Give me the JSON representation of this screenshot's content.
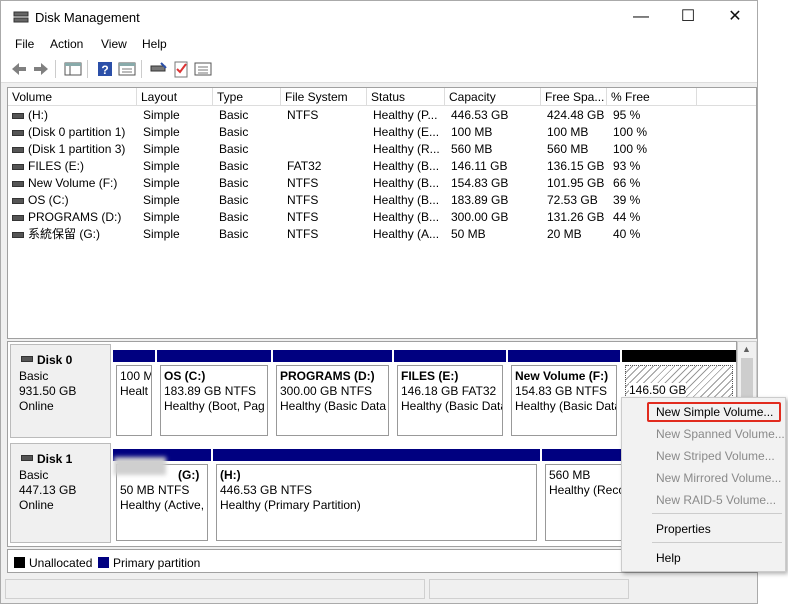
{
  "window": {
    "title": "Disk Management",
    "controls": {
      "minimize": "—",
      "maximize": "☐",
      "close": "✕"
    }
  },
  "menu": [
    "File",
    "Action",
    "View",
    "Help"
  ],
  "toolbar_icons": [
    "back-arrow-icon",
    "forward-arrow-icon",
    "console-tree-icon",
    "help-icon",
    "properties-icon",
    "disk-icon",
    "checklist-icon",
    "list-view-icon"
  ],
  "volume_list": {
    "columns": [
      "Volume",
      "Layout",
      "Type",
      "File System",
      "Status",
      "Capacity",
      "Free Spa...",
      "% Free"
    ],
    "rows": [
      [
        "(H:)",
        "Simple",
        "Basic",
        "NTFS",
        "Healthy (P...",
        "446.53 GB",
        "424.48 GB",
        "95 %"
      ],
      [
        "(Disk 0 partition 1)",
        "Simple",
        "Basic",
        "",
        "Healthy (E...",
        "100 MB",
        "100 MB",
        "100 %"
      ],
      [
        "(Disk 1 partition 3)",
        "Simple",
        "Basic",
        "",
        "Healthy (R...",
        "560 MB",
        "560 MB",
        "100 %"
      ],
      [
        "FILES (E:)",
        "Simple",
        "Basic",
        "FAT32",
        "Healthy (B...",
        "146.11 GB",
        "136.15 GB",
        "93 %"
      ],
      [
        "New Volume (F:)",
        "Simple",
        "Basic",
        "NTFS",
        "Healthy (B...",
        "154.83 GB",
        "101.95 GB",
        "66 %"
      ],
      [
        "OS (C:)",
        "Simple",
        "Basic",
        "NTFS",
        "Healthy (B...",
        "183.89 GB",
        "72.53 GB",
        "39 %"
      ],
      [
        "PROGRAMS (D:)",
        "Simple",
        "Basic",
        "NTFS",
        "Healthy (B...",
        "300.00 GB",
        "131.26 GB",
        "44 %"
      ],
      [
        "系統保留 (G:)",
        "Simple",
        "Basic",
        "NTFS",
        "Healthy (A...",
        "50 MB",
        "20 MB",
        "40 %"
      ]
    ]
  },
  "disks": [
    {
      "name": "Disk 0",
      "type": "Basic",
      "size": "931.50 GB",
      "status": "Online",
      "partitions": [
        {
          "title": "",
          "line1": "100 M",
          "line2": "Healt"
        },
        {
          "title": "OS  (C:)",
          "line1": "183.89 GB NTFS",
          "line2": "Healthy (Boot, Pag"
        },
        {
          "title": "PROGRAMS  (D:)",
          "line1": "300.00 GB NTFS",
          "line2": "Healthy (Basic Data"
        },
        {
          "title": "FILES  (E:)",
          "line1": "146.18 GB FAT32",
          "line2": "Healthy (Basic Data"
        },
        {
          "title": "New Volume  (F:)",
          "line1": "154.83 GB NTFS",
          "line2": "Healthy (Basic Data"
        },
        {
          "title": "",
          "line1": "146.50 GB",
          "line2": ""
        }
      ]
    },
    {
      "name": "Disk 1",
      "type": "Basic",
      "size": "447.13 GB",
      "status": "Online",
      "partitions": [
        {
          "title": "(G:)",
          "line1": "50 MB NTFS",
          "line2": "Healthy (Active,"
        },
        {
          "title": "(H:)",
          "line1": "446.53 GB NTFS",
          "line2": "Healthy (Primary Partition)"
        },
        {
          "title": "",
          "line1": "560 MB",
          "line2": "Healthy (Reco"
        }
      ]
    }
  ],
  "legend": [
    {
      "label": "Unallocated",
      "color": "#000000"
    },
    {
      "label": "Primary partition",
      "color": "#000080"
    }
  ],
  "context_menu": {
    "items": [
      {
        "label": "New Simple Volume...",
        "enabled": true,
        "highlighted": true
      },
      {
        "label": "New Spanned Volume...",
        "enabled": false
      },
      {
        "label": "New Striped Volume...",
        "enabled": false
      },
      {
        "label": "New Mirrored Volume...",
        "enabled": false
      },
      {
        "label": "New RAID-5 Volume...",
        "enabled": false
      },
      {
        "label": "Properties",
        "enabled": true
      },
      {
        "label": "Help",
        "enabled": true
      }
    ],
    "highlight_color": "#e12b1e"
  }
}
